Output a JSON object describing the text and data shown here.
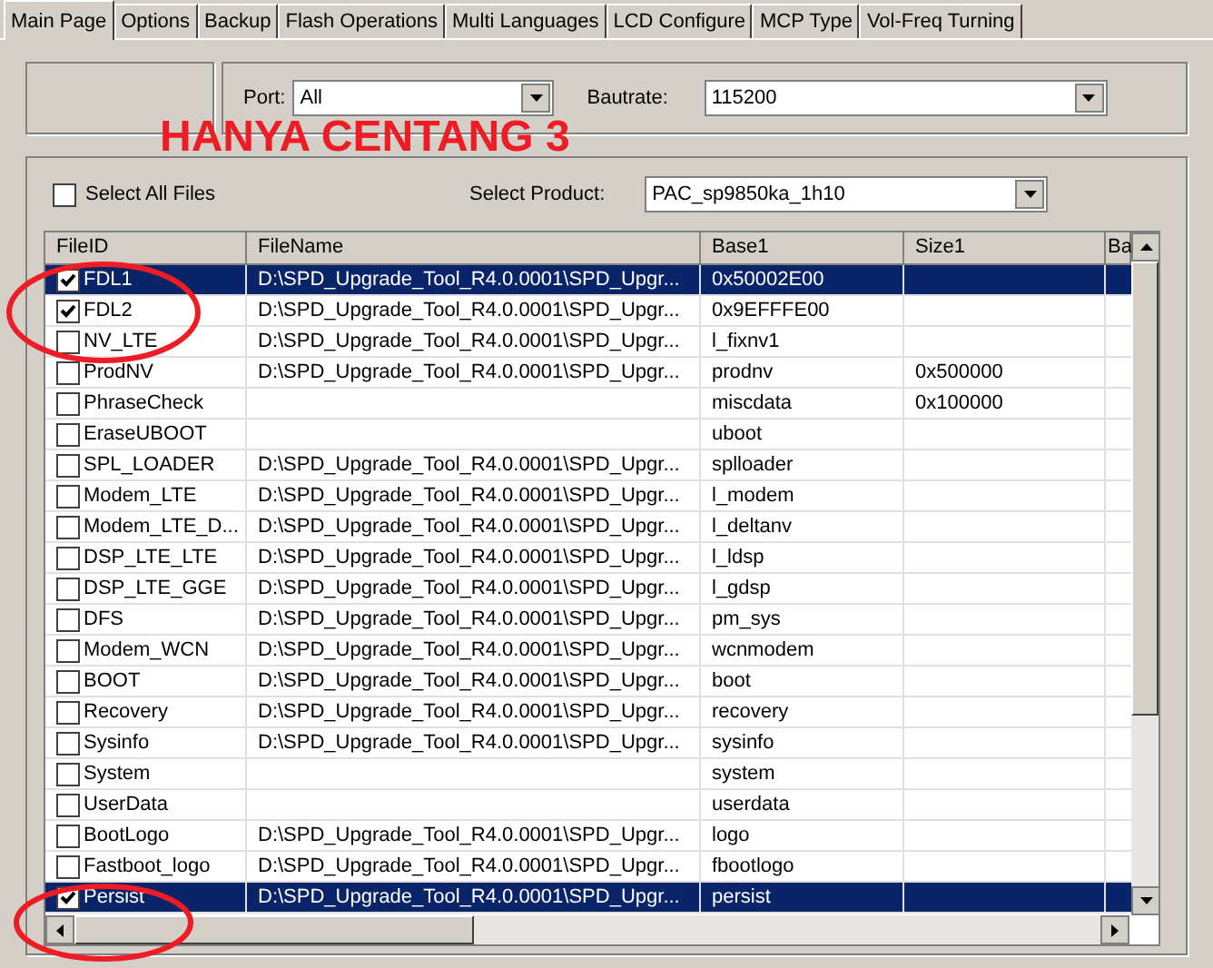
{
  "tabs": [
    {
      "label": "Main Page",
      "selected": true
    },
    {
      "label": "Options",
      "selected": false
    },
    {
      "label": "Backup",
      "selected": false
    },
    {
      "label": "Flash Operations",
      "selected": false
    },
    {
      "label": "Multi Languages",
      "selected": false
    },
    {
      "label": "LCD Configure",
      "selected": false
    },
    {
      "label": "MCP Type",
      "selected": false
    },
    {
      "label": "Vol-Freq Turning",
      "selected": false
    }
  ],
  "port": {
    "label": "Port:",
    "value": "All"
  },
  "bautrate": {
    "label": "Bautrate:",
    "value": "115200"
  },
  "annotation": {
    "text": "HANYA CENTANG 3"
  },
  "select_all": {
    "label": "Select All Files",
    "checked": false
  },
  "product": {
    "label": "Select Product:",
    "value": "PAC_sp9850ka_1h10"
  },
  "table": {
    "columns": [
      "FileID",
      "FileName",
      "Base1",
      "Size1",
      "Ba"
    ],
    "rows": [
      {
        "file_id": "FDL1",
        "file_name": "D:\\SPD_Upgrade_Tool_R4.0.0001\\SPD_Upgr...",
        "base1": "0x50002E00",
        "size1": "",
        "checked": true,
        "selected": true
      },
      {
        "file_id": "FDL2",
        "file_name": "D:\\SPD_Upgrade_Tool_R4.0.0001\\SPD_Upgr...",
        "base1": "0x9EFFFE00",
        "size1": "",
        "checked": true,
        "selected": false
      },
      {
        "file_id": "NV_LTE",
        "file_name": "D:\\SPD_Upgrade_Tool_R4.0.0001\\SPD_Upgr...",
        "base1": "l_fixnv1",
        "size1": "",
        "checked": false,
        "selected": false
      },
      {
        "file_id": "ProdNV",
        "file_name": "D:\\SPD_Upgrade_Tool_R4.0.0001\\SPD_Upgr...",
        "base1": "prodnv",
        "size1": "0x500000",
        "checked": false,
        "selected": false
      },
      {
        "file_id": "PhraseCheck",
        "file_name": "",
        "base1": "miscdata",
        "size1": "0x100000",
        "checked": false,
        "selected": false
      },
      {
        "file_id": "EraseUBOOT",
        "file_name": "",
        "base1": "uboot",
        "size1": "",
        "checked": false,
        "selected": false
      },
      {
        "file_id": "SPL_LOADER",
        "file_name": "D:\\SPD_Upgrade_Tool_R4.0.0001\\SPD_Upgr...",
        "base1": "splloader",
        "size1": "",
        "checked": false,
        "selected": false
      },
      {
        "file_id": "Modem_LTE",
        "file_name": "D:\\SPD_Upgrade_Tool_R4.0.0001\\SPD_Upgr...",
        "base1": "l_modem",
        "size1": "",
        "checked": false,
        "selected": false
      },
      {
        "file_id": "Modem_LTE_D...",
        "file_name": "D:\\SPD_Upgrade_Tool_R4.0.0001\\SPD_Upgr...",
        "base1": "l_deltanv",
        "size1": "",
        "checked": false,
        "selected": false
      },
      {
        "file_id": "DSP_LTE_LTE",
        "file_name": "D:\\SPD_Upgrade_Tool_R4.0.0001\\SPD_Upgr...",
        "base1": "l_ldsp",
        "size1": "",
        "checked": false,
        "selected": false
      },
      {
        "file_id": "DSP_LTE_GGE",
        "file_name": "D:\\SPD_Upgrade_Tool_R4.0.0001\\SPD_Upgr...",
        "base1": "l_gdsp",
        "size1": "",
        "checked": false,
        "selected": false
      },
      {
        "file_id": "DFS",
        "file_name": "D:\\SPD_Upgrade_Tool_R4.0.0001\\SPD_Upgr...",
        "base1": "pm_sys",
        "size1": "",
        "checked": false,
        "selected": false
      },
      {
        "file_id": "Modem_WCN",
        "file_name": "D:\\SPD_Upgrade_Tool_R4.0.0001\\SPD_Upgr...",
        "base1": "wcnmodem",
        "size1": "",
        "checked": false,
        "selected": false
      },
      {
        "file_id": "BOOT",
        "file_name": "D:\\SPD_Upgrade_Tool_R4.0.0001\\SPD_Upgr...",
        "base1": "boot",
        "size1": "",
        "checked": false,
        "selected": false
      },
      {
        "file_id": "Recovery",
        "file_name": "D:\\SPD_Upgrade_Tool_R4.0.0001\\SPD_Upgr...",
        "base1": "recovery",
        "size1": "",
        "checked": false,
        "selected": false
      },
      {
        "file_id": "Sysinfo",
        "file_name": "D:\\SPD_Upgrade_Tool_R4.0.0001\\SPD_Upgr...",
        "base1": "sysinfo",
        "size1": "",
        "checked": false,
        "selected": false
      },
      {
        "file_id": "System",
        "file_name": "",
        "base1": "system",
        "size1": "",
        "checked": false,
        "selected": false
      },
      {
        "file_id": "UserData",
        "file_name": "",
        "base1": "userdata",
        "size1": "",
        "checked": false,
        "selected": false
      },
      {
        "file_id": "BootLogo",
        "file_name": "D:\\SPD_Upgrade_Tool_R4.0.0001\\SPD_Upgr...",
        "base1": "logo",
        "size1": "",
        "checked": false,
        "selected": false
      },
      {
        "file_id": "Fastboot_logo",
        "file_name": "D:\\SPD_Upgrade_Tool_R4.0.0001\\SPD_Upgr...",
        "base1": "fbootlogo",
        "size1": "",
        "checked": false,
        "selected": false
      },
      {
        "file_id": "Persist",
        "file_name": "D:\\SPD_Upgrade_Tool_R4.0.0001\\SPD_Upgr...",
        "base1": "persist",
        "size1": "",
        "checked": true,
        "selected": true
      }
    ]
  }
}
